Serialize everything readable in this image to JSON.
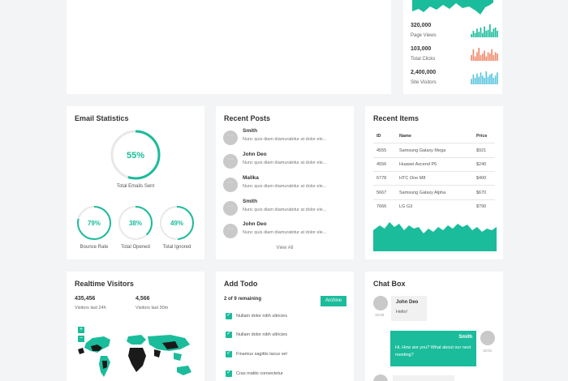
{
  "colors": {
    "accent": "#1bbc9b",
    "coral": "#f08a6c",
    "sky": "#5bc6df",
    "muted": "#c9c9c9"
  },
  "site_stats": [
    {
      "value": "320,000",
      "label": "Page Views",
      "color": "#1bbc9b",
      "bars": [
        3,
        6,
        4,
        8,
        5,
        9,
        4,
        10,
        6,
        7,
        12,
        5,
        8,
        9,
        6
      ]
    },
    {
      "value": "103,000",
      "label": "Total Clicks",
      "color": "#f08a6c",
      "bars": [
        4,
        8,
        3,
        6,
        9,
        4,
        5,
        7,
        3,
        6,
        5,
        8,
        4,
        6,
        5
      ]
    },
    {
      "value": "2,400,000",
      "label": "Site Visitors",
      "color": "#5bc6df",
      "bars": [
        5,
        9,
        6,
        10,
        7,
        11,
        8,
        6,
        12,
        7,
        9,
        10,
        6,
        8,
        11
      ]
    }
  ],
  "email": {
    "title": "Email Statistics",
    "main": {
      "percent": 55,
      "text": "55%",
      "label": "Total Emails Sent"
    },
    "small": [
      {
        "percent": 79,
        "text": "79%",
        "label": "Bounce Rate"
      },
      {
        "percent": 38,
        "text": "38%",
        "label": "Total Opened"
      },
      {
        "percent": 49,
        "text": "49%",
        "label": "Total Ignored"
      }
    ]
  },
  "posts": {
    "title": "Recent Posts",
    "items": [
      {
        "name": "Smith",
        "text": "Nunc quis diam diamurabitur at dolor ele..."
      },
      {
        "name": "John Deo",
        "text": "Nunc quis diam diamurabitur at dolor ele..."
      },
      {
        "name": "Mallka",
        "text": "Nunc quis diam diamurabitur at dolor ele..."
      },
      {
        "name": "Smith",
        "text": "Nunc quis diam diamurabitur at dolor ele..."
      },
      {
        "name": "John Deo",
        "text": "Nunc quis diam diamurabitur at dolor ele..."
      }
    ],
    "view_all": "View All"
  },
  "items": {
    "title": "Recent Items",
    "headers": [
      "ID",
      "Name",
      "Price"
    ],
    "rows": [
      [
        "4555",
        "Samsung Galaxy Mega",
        "$921"
      ],
      [
        "4556",
        "Huawei Ascend P6",
        "$240"
      ],
      [
        "6778",
        "HTC One M8",
        "$400"
      ],
      [
        "5667",
        "Samsung Galaxy Alpha",
        "$670"
      ],
      [
        "7666",
        "LG G3",
        "$790"
      ]
    ]
  },
  "visitors": {
    "title": "Realtime Visitors",
    "stats": [
      {
        "value": "435,456",
        "label": "Visitors last 24h"
      },
      {
        "value": "4,566",
        "label": "Visitors last 30m"
      }
    ],
    "zoom_in": "+",
    "zoom_out": "−"
  },
  "todo": {
    "title": "Add Todo",
    "remaining": "2 of 9 remaining",
    "archive": "Archive",
    "items": [
      "Nullam dolor nibh ultricies",
      "Nullam dolor nibh ultricies",
      "Finamus sagittis lacus vel",
      "Cras mattis consectetur"
    ]
  },
  "chat": {
    "title": "Chat Box",
    "messages": [
      {
        "name": "John Deo",
        "text": "Hello!",
        "time": "10:00"
      },
      {
        "name": "Smith",
        "text": "Hi, How are you? What about our next meeting?",
        "time": "10:01"
      }
    ]
  }
}
